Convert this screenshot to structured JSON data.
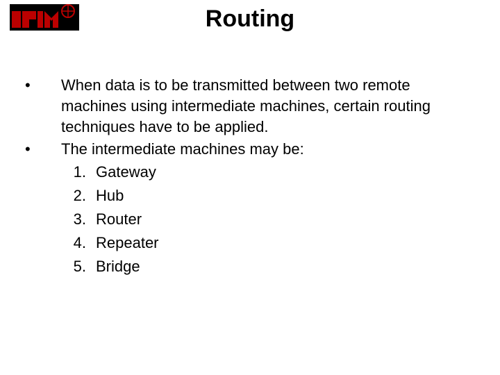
{
  "title": "Routing",
  "logo_alt": "NDIM logo",
  "bullets": [
    "When data is to be transmitted between two remote machines using intermediate machines, certain routing techniques have to be applied.",
    "The intermediate machines may be:"
  ],
  "items": [
    {
      "n": "1.",
      "t": "Gateway"
    },
    {
      "n": "2.",
      "t": "Hub"
    },
    {
      "n": "3.",
      "t": "Router"
    },
    {
      "n": "4.",
      "t": "Repeater"
    },
    {
      "n": "5.",
      "t": "Bridge"
    }
  ]
}
